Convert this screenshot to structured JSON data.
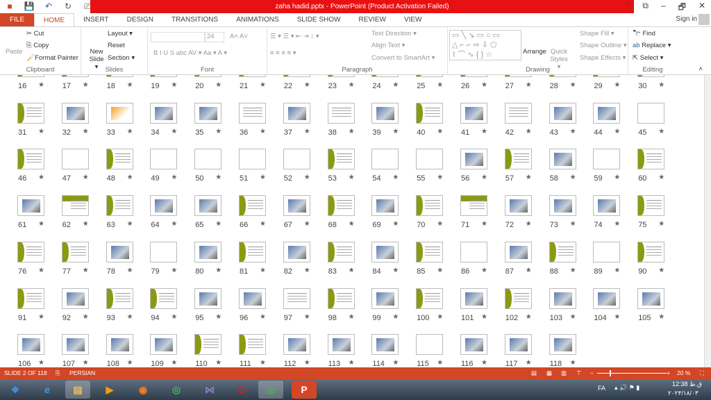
{
  "title": "zaha hadid.pptx -  PowerPoint (Product Activation Failed)",
  "window_buttons": [
    "?",
    "⧉",
    "–",
    "🗗",
    "✕"
  ],
  "tabs": [
    "FILE",
    "HOME",
    "INSERT",
    "DESIGN",
    "TRANSITIONS",
    "ANIMATIONS",
    "SLIDE SHOW",
    "REVIEW",
    "VIEW"
  ],
  "active_tab": "HOME",
  "sign_in": "Sign in",
  "ribbon": {
    "clipboard": {
      "label": "Clipboard",
      "paste": "Paste",
      "cut": "Cut",
      "copy": "Copy",
      "format_painter": "Format Painter"
    },
    "slides": {
      "label": "Slides",
      "new_slide": "New Slide ▾",
      "layout": "Layout ▾",
      "reset": "Reset",
      "section": "Section ▾"
    },
    "font": {
      "label": "Font",
      "font_name": "",
      "font_size": "24",
      "buttons": "B  I  U  S  abc  AV ▾  Aa ▾   A ▾"
    },
    "paragraph": {
      "label": "Paragraph",
      "text_direction": "Text Direction ▾",
      "align_text": "Align Text ▾",
      "convert_smartart": "Convert to SmartArt ▾"
    },
    "drawing": {
      "label": "Drawing",
      "arrange": "Arrange",
      "quick_styles": "Quick Styles ▾",
      "shape_fill": "Shape Fill ▾",
      "shape_outline": "Shape Outline ▾",
      "shape_effects": "Shape Effects ▾"
    },
    "editing": {
      "label": "Editing",
      "find": "Find",
      "replace": "Replace ▾",
      "select": "Select ▾"
    }
  },
  "slide_rows": [
    {
      "start": 16,
      "types": "ggggggggggggggg"
    },
    {
      "start": 31,
      "types": "gpopptptpgptppw"
    },
    {
      "start": 46,
      "types": "gwgwwwwgwwpgpwg"
    },
    {
      "start": 61,
      "types": "pbgppgpgpgbpppg"
    },
    {
      "start": 76,
      "types": "ggpwpgpgpgwpgwg"
    },
    {
      "start": 91,
      "types": "gpggpptgpgpgppp"
    },
    {
      "start": 106,
      "types": "ppppggpppwppp"
    }
  ],
  "status": {
    "slide": "SLIDE 2 OF 118",
    "language": "PERSIAN",
    "zoom": "20 %",
    "zoom_value": 20
  },
  "taskbar": {
    "lang": "FA",
    "time": "12:38 ق.ظ",
    "date": "۲۰۲۴/۱۸/۰۳"
  }
}
